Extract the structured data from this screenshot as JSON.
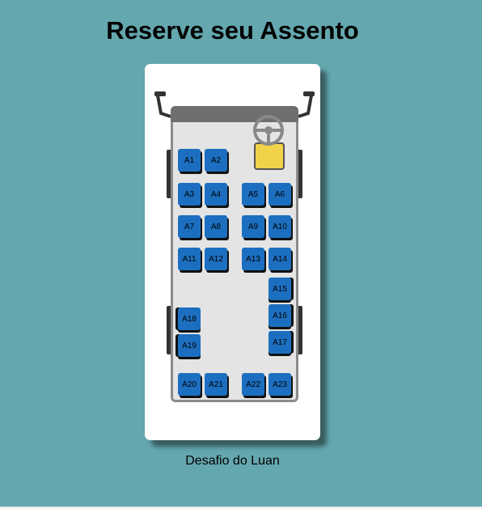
{
  "header": {
    "title": "Reserve seu Assento"
  },
  "seats": [
    {
      "label": "A1"
    },
    {
      "label": "A2"
    },
    {
      "label": "A3"
    },
    {
      "label": "A4"
    },
    {
      "label": "A5"
    },
    {
      "label": "A6"
    },
    {
      "label": "A7"
    },
    {
      "label": "A8"
    },
    {
      "label": "A9"
    },
    {
      "label": "A10"
    },
    {
      "label": "A11"
    },
    {
      "label": "A12"
    },
    {
      "label": "A13"
    },
    {
      "label": "A14"
    },
    {
      "label": "A15"
    },
    {
      "label": "A16"
    },
    {
      "label": "A17"
    },
    {
      "label": "A18"
    },
    {
      "label": "A19"
    },
    {
      "label": "A20"
    },
    {
      "label": "A21"
    },
    {
      "label": "A22"
    },
    {
      "label": "A23"
    }
  ],
  "footer": {
    "text": "Desafio do Luan"
  },
  "colors": {
    "background": "#64a7ae",
    "seat": "#1c6fc0",
    "driver_seat": "#f1d34a"
  },
  "icons": {
    "steering": "steering-wheel-icon",
    "mirrors": "side-mirror-icon"
  }
}
